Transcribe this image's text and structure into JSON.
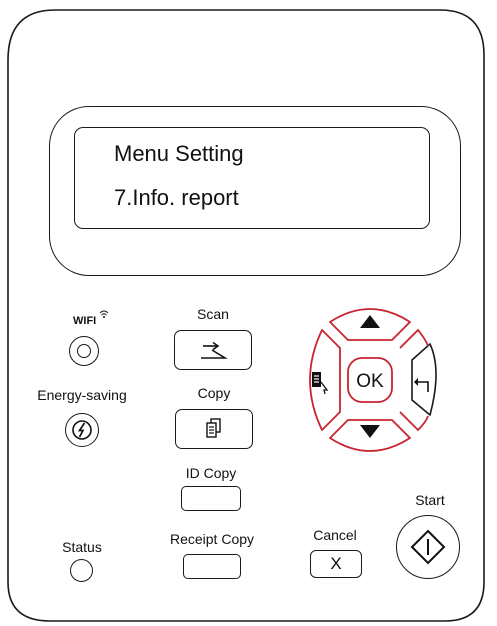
{
  "screen": {
    "line1": "Menu Setting",
    "line2": "7.Info. report"
  },
  "buttons": {
    "wifi_label": "WIFI",
    "scan_label": "Scan",
    "energy_label": "Energy-saving",
    "copy_label": "Copy",
    "id_copy_label": "ID Copy",
    "status_label": "Status",
    "receipt_copy_label": "Receipt Copy",
    "cancel_label": "Cancel",
    "cancel_key": "X",
    "ok_label": "OK",
    "start_label": "Start"
  },
  "colors": {
    "accent_red": "#c8242f",
    "outline": "#1a1a1a"
  },
  "icons": {
    "wifi": "wifi-icon",
    "scan": "scan-icon",
    "copy": "copy-icon",
    "menu": "menu-icon",
    "back": "back-icon",
    "up": "up-arrow-icon",
    "down": "down-arrow-icon",
    "energy": "power-icon",
    "start": "start-icon"
  }
}
